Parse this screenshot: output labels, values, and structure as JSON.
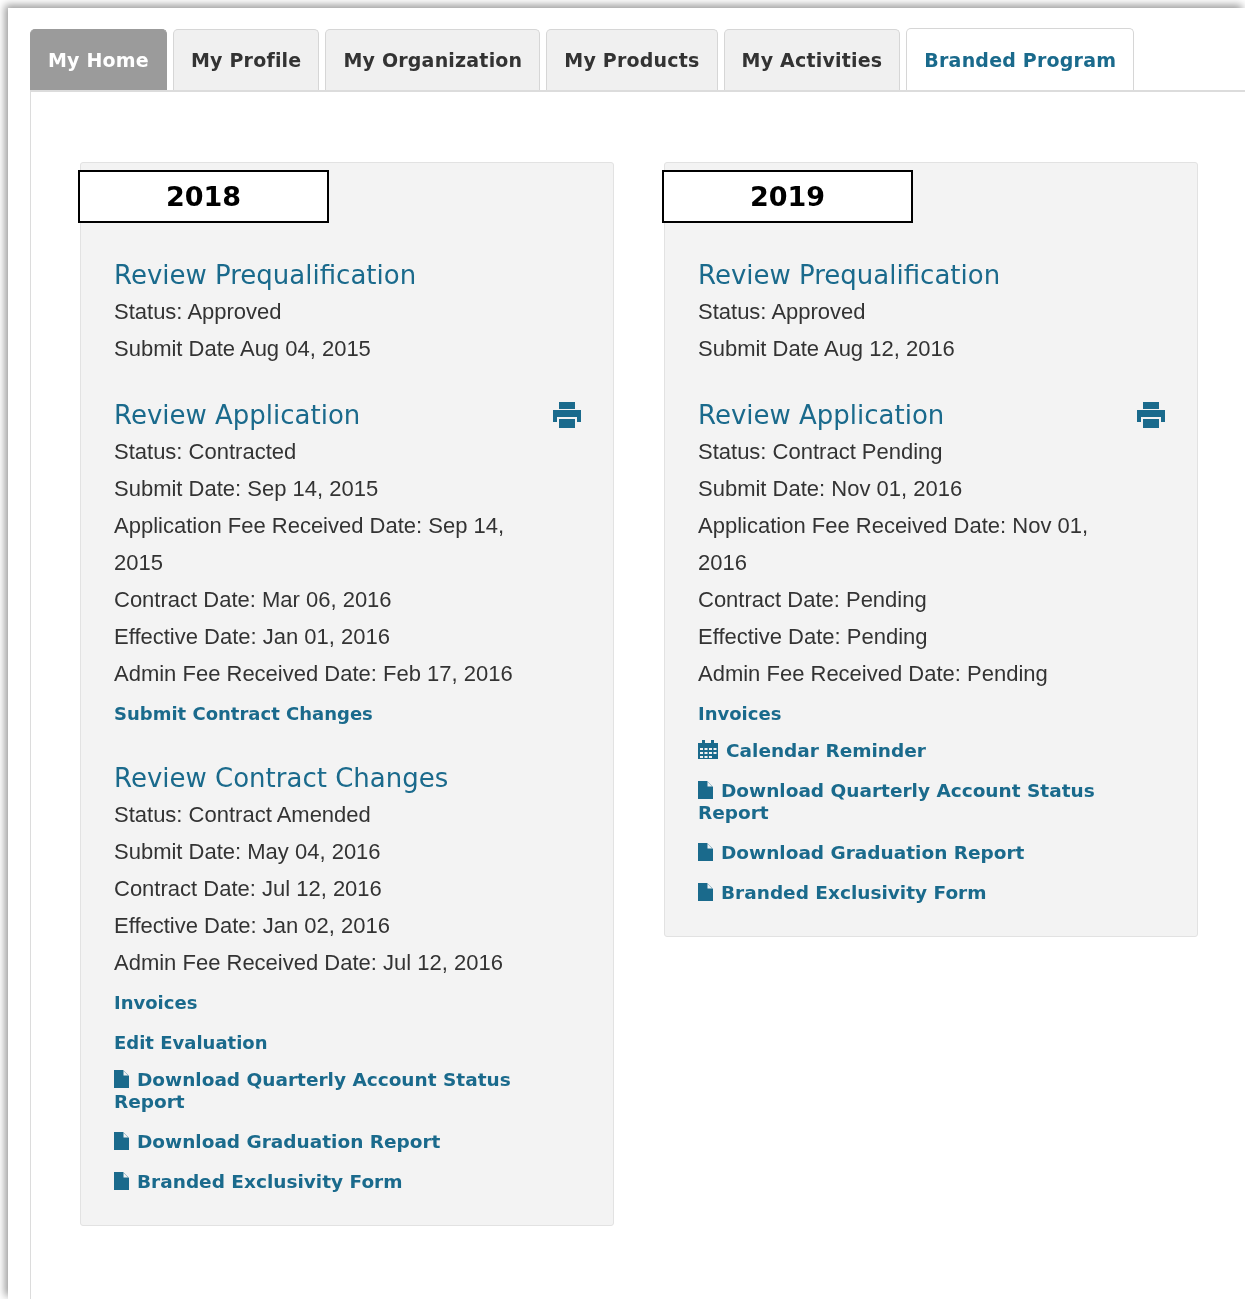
{
  "tabs": [
    {
      "label": "My Home",
      "selected": false,
      "highlighted": true
    },
    {
      "label": "My Profile",
      "selected": false,
      "highlighted": false
    },
    {
      "label": "My Organization",
      "selected": false,
      "highlighted": false
    },
    {
      "label": "My Products",
      "selected": false,
      "highlighted": false
    },
    {
      "label": "My Activities",
      "selected": false,
      "highlighted": false
    },
    {
      "label": "Branded Program",
      "selected": true,
      "highlighted": false
    }
  ],
  "cards": [
    {
      "year": "2018",
      "blocks": [
        {
          "kind": "section",
          "title": "Review Prequalification",
          "printable": false,
          "lines": [
            "Status: Approved",
            "Submit Date Aug 04, 2015"
          ]
        },
        {
          "kind": "section",
          "title": "Review Application",
          "printable": true,
          "lines": [
            "Status: Contracted",
            "Submit Date: Sep 14, 2015",
            "Application Fee Received Date: Sep 14, 2015",
            "Contract Date: Mar 06, 2016",
            "Effective Date: Jan 01, 2016",
            "Admin Fee Received Date: Feb 17, 2016"
          ]
        },
        {
          "kind": "action",
          "text": "Submit Contract Changes"
        },
        {
          "kind": "section",
          "title": "Review Contract Changes",
          "printable": false,
          "lines": [
            "Status: Contract Amended",
            "Submit Date: May 04, 2016",
            "Contract Date: Jul 12, 2016",
            "Effective Date: Jan 02, 2016",
            "Admin Fee Received Date: Jul 12, 2016"
          ]
        },
        {
          "kind": "action",
          "text": "Invoices"
        },
        {
          "kind": "action",
          "text": "Edit Evaluation"
        },
        {
          "kind": "link",
          "text": "Download Quarterly Account Status Report"
        },
        {
          "kind": "link",
          "text": "Download Graduation Report"
        },
        {
          "kind": "link",
          "text": "Branded Exclusivity Form"
        }
      ]
    },
    {
      "year": "2019",
      "blocks": [
        {
          "kind": "section",
          "title": "Review Prequalification",
          "printable": false,
          "lines": [
            "Status: Approved",
            "Submit Date Aug 12, 2016"
          ]
        },
        {
          "kind": "section",
          "title": "Review Application",
          "printable": true,
          "lines": [
            "Status: Contract Pending",
            "Submit Date: Nov 01, 2016",
            "Application Fee Received Date: Nov 01, 2016",
            "Contract Date: Pending",
            "Effective Date: Pending",
            "Admin Fee Received Date: Pending"
          ]
        },
        {
          "kind": "action",
          "text": "Invoices"
        },
        {
          "kind": "reminder",
          "text": "Calendar Reminder"
        },
        {
          "kind": "link",
          "text": "Download Quarterly Account Status Report"
        },
        {
          "kind": "link",
          "text": "Download Graduation Report"
        },
        {
          "kind": "link",
          "text": "Branded Exclusivity Form"
        }
      ]
    }
  ]
}
